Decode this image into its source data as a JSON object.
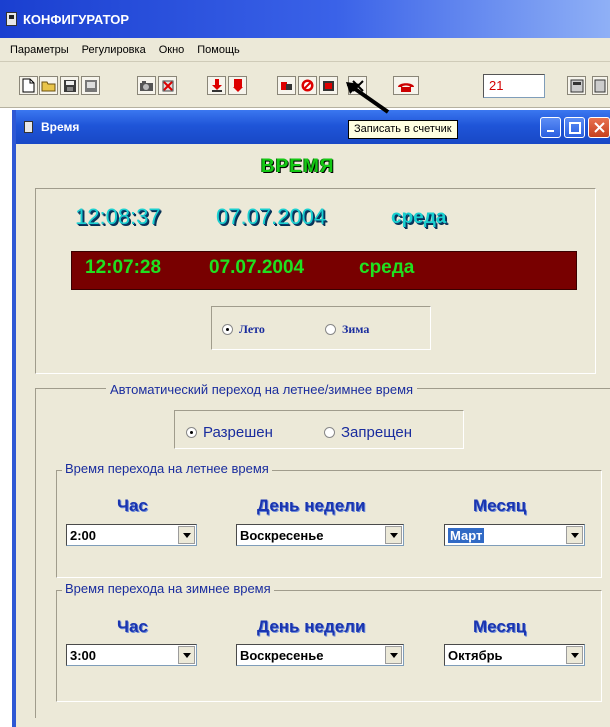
{
  "app": {
    "title": "КОНФИГУРАТОР"
  },
  "menu": [
    "Параметры",
    "Регулировка",
    "Окно",
    "Помощь"
  ],
  "toolbar": {
    "buttons": [
      "new-document-icon",
      "open-folder-icon",
      "save-disk-icon",
      "save-as-icon",
      "camera-icon",
      "delete-x-icon",
      "read-down-icon",
      "read-meter-icon",
      "flag-write-icon",
      "stop-icon",
      "write-to-meter-icon",
      "close-x-icon",
      "telephone-icon",
      "meter-panel-icon",
      "panel-icon"
    ],
    "counter_value": "21",
    "tooltip": "Записать в счетчик"
  },
  "window": {
    "title": "Время"
  },
  "clock": {
    "heading": "ВРЕМЯ",
    "pc_time": "12:08:37",
    "pc_date": "07.07.2004",
    "pc_day": "среда",
    "meter_time": "12:07:28",
    "meter_date": "07.07.2004",
    "meter_day": "среда",
    "season_summer": "Лето",
    "season_winter": "Зима",
    "season_selected": "Лето"
  },
  "auto_switch": {
    "caption": "Автоматический переход на летнее/зимнее время",
    "allowed": "Разрешен",
    "forbidden": "Запрещен",
    "selected": "Разрешен",
    "summer": {
      "caption": "Время перехода на летнее время",
      "hour_label": "Час",
      "day_label": "День недели",
      "month_label": "Месяц",
      "hour": "2:00",
      "day": "Воскресенье",
      "month": "Март"
    },
    "winter": {
      "caption": "Время перехода на зимнее время",
      "hour_label": "Час",
      "day_label": "День недели",
      "month_label": "Месяц",
      "hour": "3:00",
      "day": "Воскресенье",
      "month": "Октябрь"
    }
  },
  "colors": {
    "meter_bar": "#780000",
    "meter_text": "#20e020",
    "pc_text": "#1ad0d0",
    "label_blue": "#1a35b0"
  }
}
